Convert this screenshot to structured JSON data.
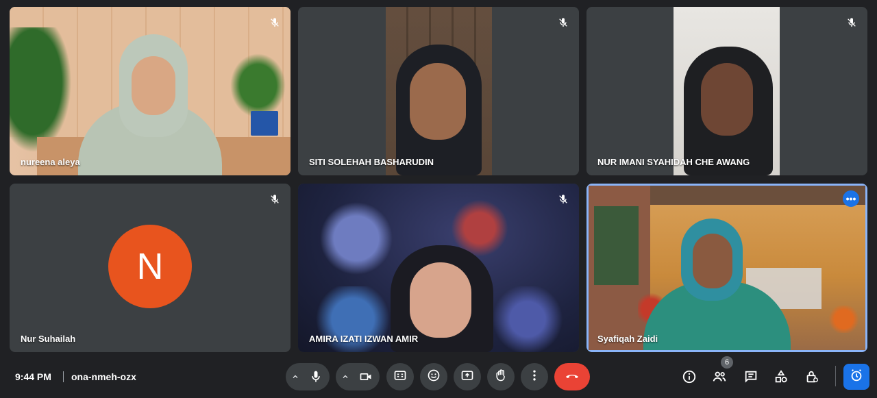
{
  "meeting": {
    "time": "9:44 PM",
    "code": "ona-nmeh-ozx"
  },
  "participants": [
    {
      "name": "nureena aleya",
      "muted": true
    },
    {
      "name": "SITI SOLEHAH BASHARUDIN",
      "muted": true
    },
    {
      "name": "NUR IMANI SYAHIDAH CHE AWANG",
      "muted": true
    },
    {
      "name": "Nur Suhailah",
      "muted": true,
      "avatar_letter": "N",
      "avatar_color": "#e8541e"
    },
    {
      "name": "AMIRA IZATI IZWAN AMIR",
      "muted": true
    },
    {
      "name": "Syafiqah Zaidi",
      "muted": false,
      "active": true
    }
  ],
  "controls": {
    "people_count": "6",
    "more_dots": "•••"
  },
  "colors": {
    "background": "#202124",
    "tile": "#3c4043",
    "end_call": "#ea4335",
    "accent": "#1a73e8",
    "active_outline": "#8ab4f8"
  },
  "icons": [
    "mic-icon",
    "camera-icon",
    "captions-icon",
    "emoji-icon",
    "present-icon",
    "raise-hand-icon",
    "more-options-icon",
    "end-call-icon",
    "info-icon",
    "people-icon",
    "chat-icon",
    "activities-icon",
    "host-controls-icon",
    "timer-icon"
  ]
}
